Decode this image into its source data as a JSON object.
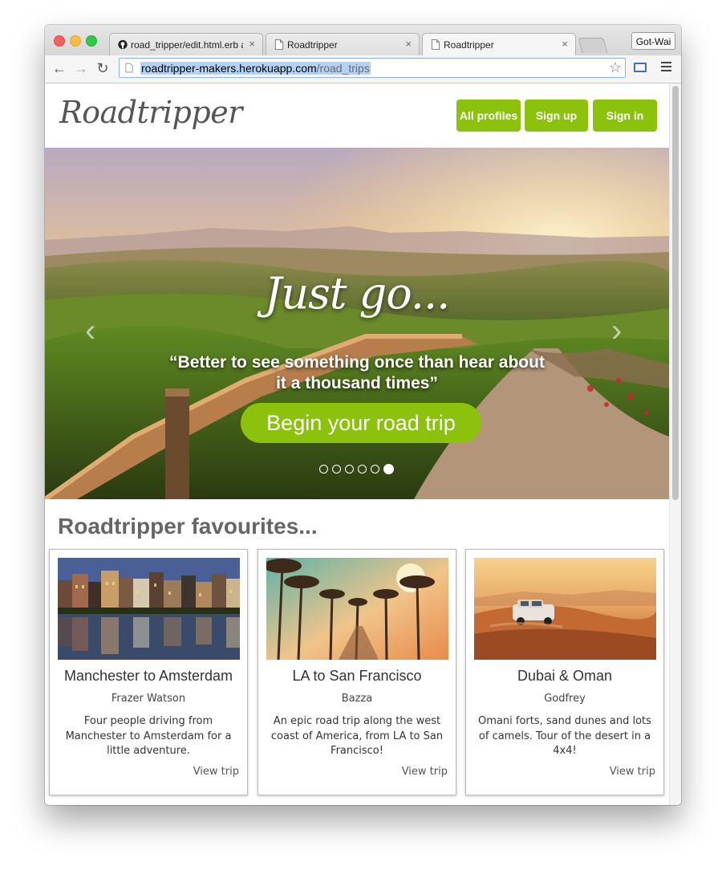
{
  "browser": {
    "tabs": [
      {
        "label": "road_tripper/edit.html.erb a",
        "close": "×"
      },
      {
        "label": "Roadtripper",
        "close": "×"
      },
      {
        "label": "Roadtripper",
        "close": "×"
      }
    ],
    "profile_button": "Got-Wai",
    "url": {
      "host": "roadtripper-makers.herokuapp.com",
      "path": "/road_trips"
    }
  },
  "site": {
    "logo": "Roadtripper",
    "nav": {
      "all_profiles": "All profiles",
      "sign_up": "Sign up",
      "sign_in": "Sign in"
    },
    "accent_color": "#8cc10c"
  },
  "hero": {
    "title": "Just go...",
    "quote": "“Better to see something once than hear about it a thousand times”",
    "cta": "Begin your road trip",
    "prev_arrow": "‹",
    "next_arrow": "›",
    "slide_count": 6,
    "active_slide": 6
  },
  "favourites": {
    "title": "Roadtripper favourites...",
    "cards": [
      {
        "title": "Manchester to Amsterdam",
        "author": "Frazer Watson",
        "description": "Four people driving from Manchester to Amsterdam for a little adventure.",
        "link": "View trip"
      },
      {
        "title": "LA to San Francisco",
        "author": "Bazza",
        "description": "An epic road trip along the west coast of America, from LA to San Francisco!",
        "link": "View trip"
      },
      {
        "title": "Dubai & Oman",
        "author": "Godfrey",
        "description": "Omani forts, sand dunes and lots of camels. Tour of the desert in a 4x4!",
        "link": "View trip"
      }
    ]
  }
}
